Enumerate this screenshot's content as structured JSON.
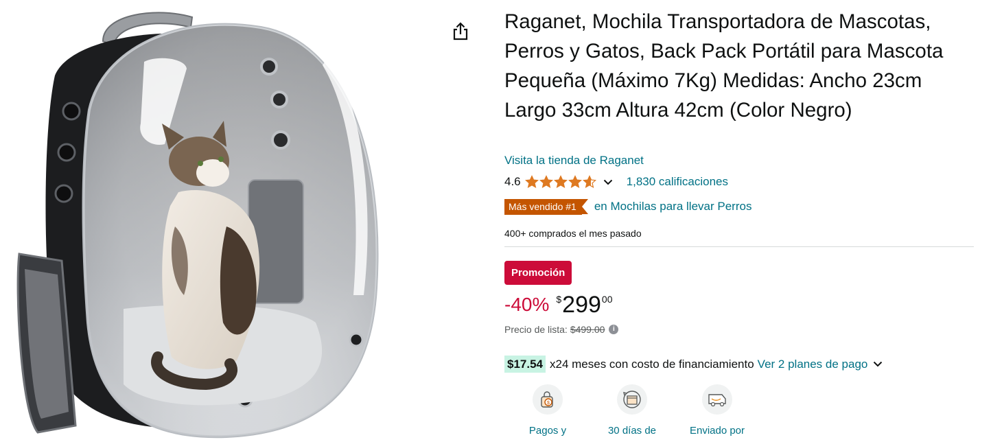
{
  "product": {
    "title": "Raganet, Mochila Transportadora de Mascotas, Perros y Gatos, Back Pack Portátil para Mascota Pequeña (Máximo 7Kg) Medidas: Ancho 23cm Largo 33cm Altura 42cm (Color Negro)",
    "store_link": "Visita la tienda de Raganet"
  },
  "rating": {
    "value": "4.6",
    "stars": 4.6,
    "count_label": "1,830 calificaciones"
  },
  "bestseller": {
    "badge": "Más vendido #1",
    "category": "en Mochilas para llevar Perros"
  },
  "bought": "400+ comprados el mes pasado",
  "pricing": {
    "promo_badge": "Promoción",
    "discount": "-40%",
    "currency_symbol": "$",
    "price_whole": "299",
    "price_fraction": "00",
    "list_price_label": "Precio de lista:",
    "list_price": "$499.00"
  },
  "financing": {
    "installment_amount": "$17.54",
    "months_text": "x24 meses con costo de financiamiento",
    "plans_link": "Ver 2 planes de pago"
  },
  "features": [
    {
      "label": "Pagos y",
      "icon": "secure-payment-icon"
    },
    {
      "label": "30 días de",
      "icon": "returns-box-icon"
    },
    {
      "label": "Enviado por",
      "icon": "delivery-truck-icon"
    }
  ],
  "colors": {
    "link": "#007185",
    "deal_red": "#cc0c39",
    "bestseller_orange": "#c45500",
    "star": "#de7921",
    "installment_bg": "#c8f3e3"
  }
}
